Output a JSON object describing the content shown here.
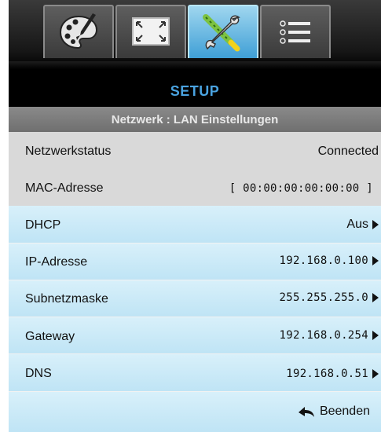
{
  "menu": {
    "title": "SETUP",
    "subtitle": "Netzwerk : LAN Einstellungen"
  },
  "tabs": [
    {
      "icon": "palette-icon",
      "active": false
    },
    {
      "icon": "screen-resize-icon",
      "active": false
    },
    {
      "icon": "tools-icon",
      "active": true
    },
    {
      "icon": "list-icon",
      "active": false
    }
  ],
  "rows": {
    "status": {
      "label": "Netzwerkstatus",
      "value": "Connected"
    },
    "mac": {
      "label": "MAC-Adresse",
      "value": "[ 00:00:00:00:00:00 ]"
    },
    "dhcp": {
      "label": "DHCP",
      "value": "Aus"
    },
    "ip": {
      "label": "IP-Adresse",
      "value": "192.168.0.100"
    },
    "subnet": {
      "label": "Subnetzmaske",
      "value": "255.255.255.0"
    },
    "gateway": {
      "label": "Gateway",
      "value": "192.168.0.254"
    },
    "dns": {
      "label": "DNS",
      "value": "192.168.0.51"
    },
    "exit": {
      "label": "Beenden",
      "icon": "return-arrow-icon"
    }
  },
  "colors": {
    "title": "#4aa3e0",
    "active_tab": "#3f9fd6",
    "editable_row": "#c8e9f7",
    "static_row": "#d9d9d9"
  }
}
